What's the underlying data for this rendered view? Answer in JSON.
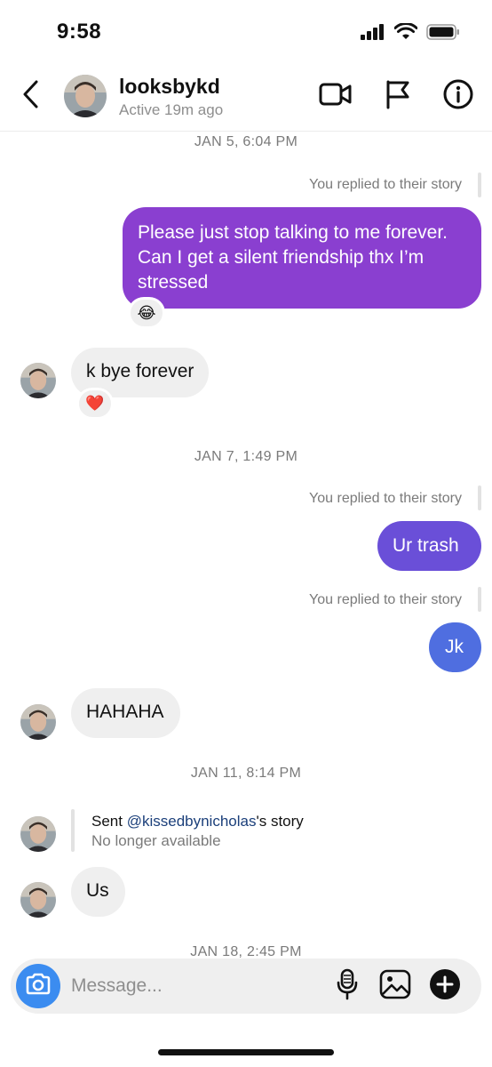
{
  "status_bar": {
    "time": "9:58"
  },
  "header": {
    "back_icon": "chevron-left-icon",
    "username": "looksbykd",
    "status": "Active 19m ago",
    "icons": [
      "video-call-icon",
      "flag-icon",
      "info-icon"
    ]
  },
  "thread": {
    "ts1": "JAN 5, 6:04 PM",
    "reply_note_1": "You replied to their story",
    "msg1": "Please just stop talking to me forever. Can I get a silent friendship thx I’m stressed",
    "msg1_reaction": "😂",
    "msg2": "k bye forever",
    "msg2_reaction": "❤️",
    "ts2": "JAN 7, 1:49 PM",
    "reply_note_2": "You replied to their story",
    "msg3": "Ur trash",
    "reply_note_3": "You replied to their story",
    "msg4": "Jk",
    "msg5": "HAHAHA",
    "ts3": "JAN 11, 8:14 PM",
    "story_sent_prefix": "Sent ",
    "story_sent_handle": "@kissedbynicholas",
    "story_sent_suffix": "'s story",
    "story_unavailable": "No longer available",
    "msg6": "Us",
    "ts4": "JAN 18, 2:45 PM"
  },
  "composer": {
    "placeholder": "Message...",
    "icons": [
      "camera-icon",
      "microphone-icon",
      "gallery-icon",
      "plus-icon"
    ]
  },
  "colors": {
    "outgoing_purple": "#8a3fd0",
    "outgoing_violet": "#6a4fd8",
    "outgoing_blue": "#4f6ee0",
    "incoming_bubble": "#efefef",
    "link_blue": "#1b3f7a",
    "camera_blue": "#3b8cf0"
  }
}
